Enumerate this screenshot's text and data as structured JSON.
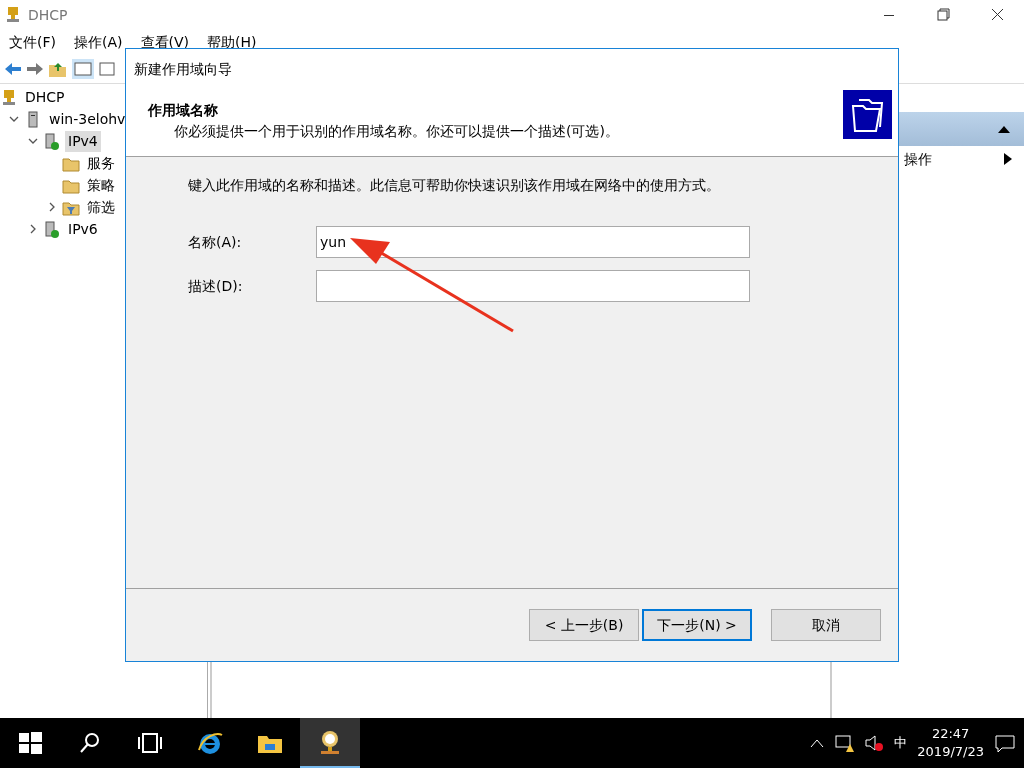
{
  "window": {
    "title": "DHCP"
  },
  "menu": [
    "文件(F)",
    "操作(A)",
    "查看(V)",
    "帮助(H)"
  ],
  "tree": [
    {
      "label": "DHCP",
      "kind": "dhcp",
      "selected": false,
      "children": [
        {
          "label": "win-3elohv",
          "kind": "server",
          "expanded": true,
          "selected": false,
          "children": [
            {
              "label": "IPv4",
              "kind": "ip",
              "expanded": true,
              "selected": true,
              "children": [
                {
                  "label": "服务",
                  "kind": "folder",
                  "selected": false
                },
                {
                  "label": "策略",
                  "kind": "folder",
                  "selected": false
                },
                {
                  "label": "筛选",
                  "kind": "filter",
                  "expanded": false,
                  "selected": false
                }
              ]
            },
            {
              "label": "IPv6",
              "kind": "ip",
              "expanded": false,
              "selected": false
            }
          ]
        }
      ]
    }
  ],
  "actions": {
    "item": "操作"
  },
  "dialog": {
    "title": "新建作用域向导",
    "heading": "作用域名称",
    "subheading": "你必须提供一个用于识别的作用域名称。你还可以提供一个描述(可选)。",
    "instruction": "键入此作用域的名称和描述。此信息可帮助你快速识别该作用域在网络中的使用方式。",
    "fields": [
      {
        "label": "名称(A):",
        "value": "yun"
      },
      {
        "label": "描述(D):"
      }
    ],
    "buttons": [
      {
        "label": "< 上一步(B)",
        "default": false
      },
      {
        "label": "下一步(N) >",
        "default": true
      },
      {
        "label": "取消",
        "default": false
      }
    ]
  },
  "taskbar": {
    "time": "22:47",
    "date": "2019/7/23",
    "tray_ime": "中"
  }
}
